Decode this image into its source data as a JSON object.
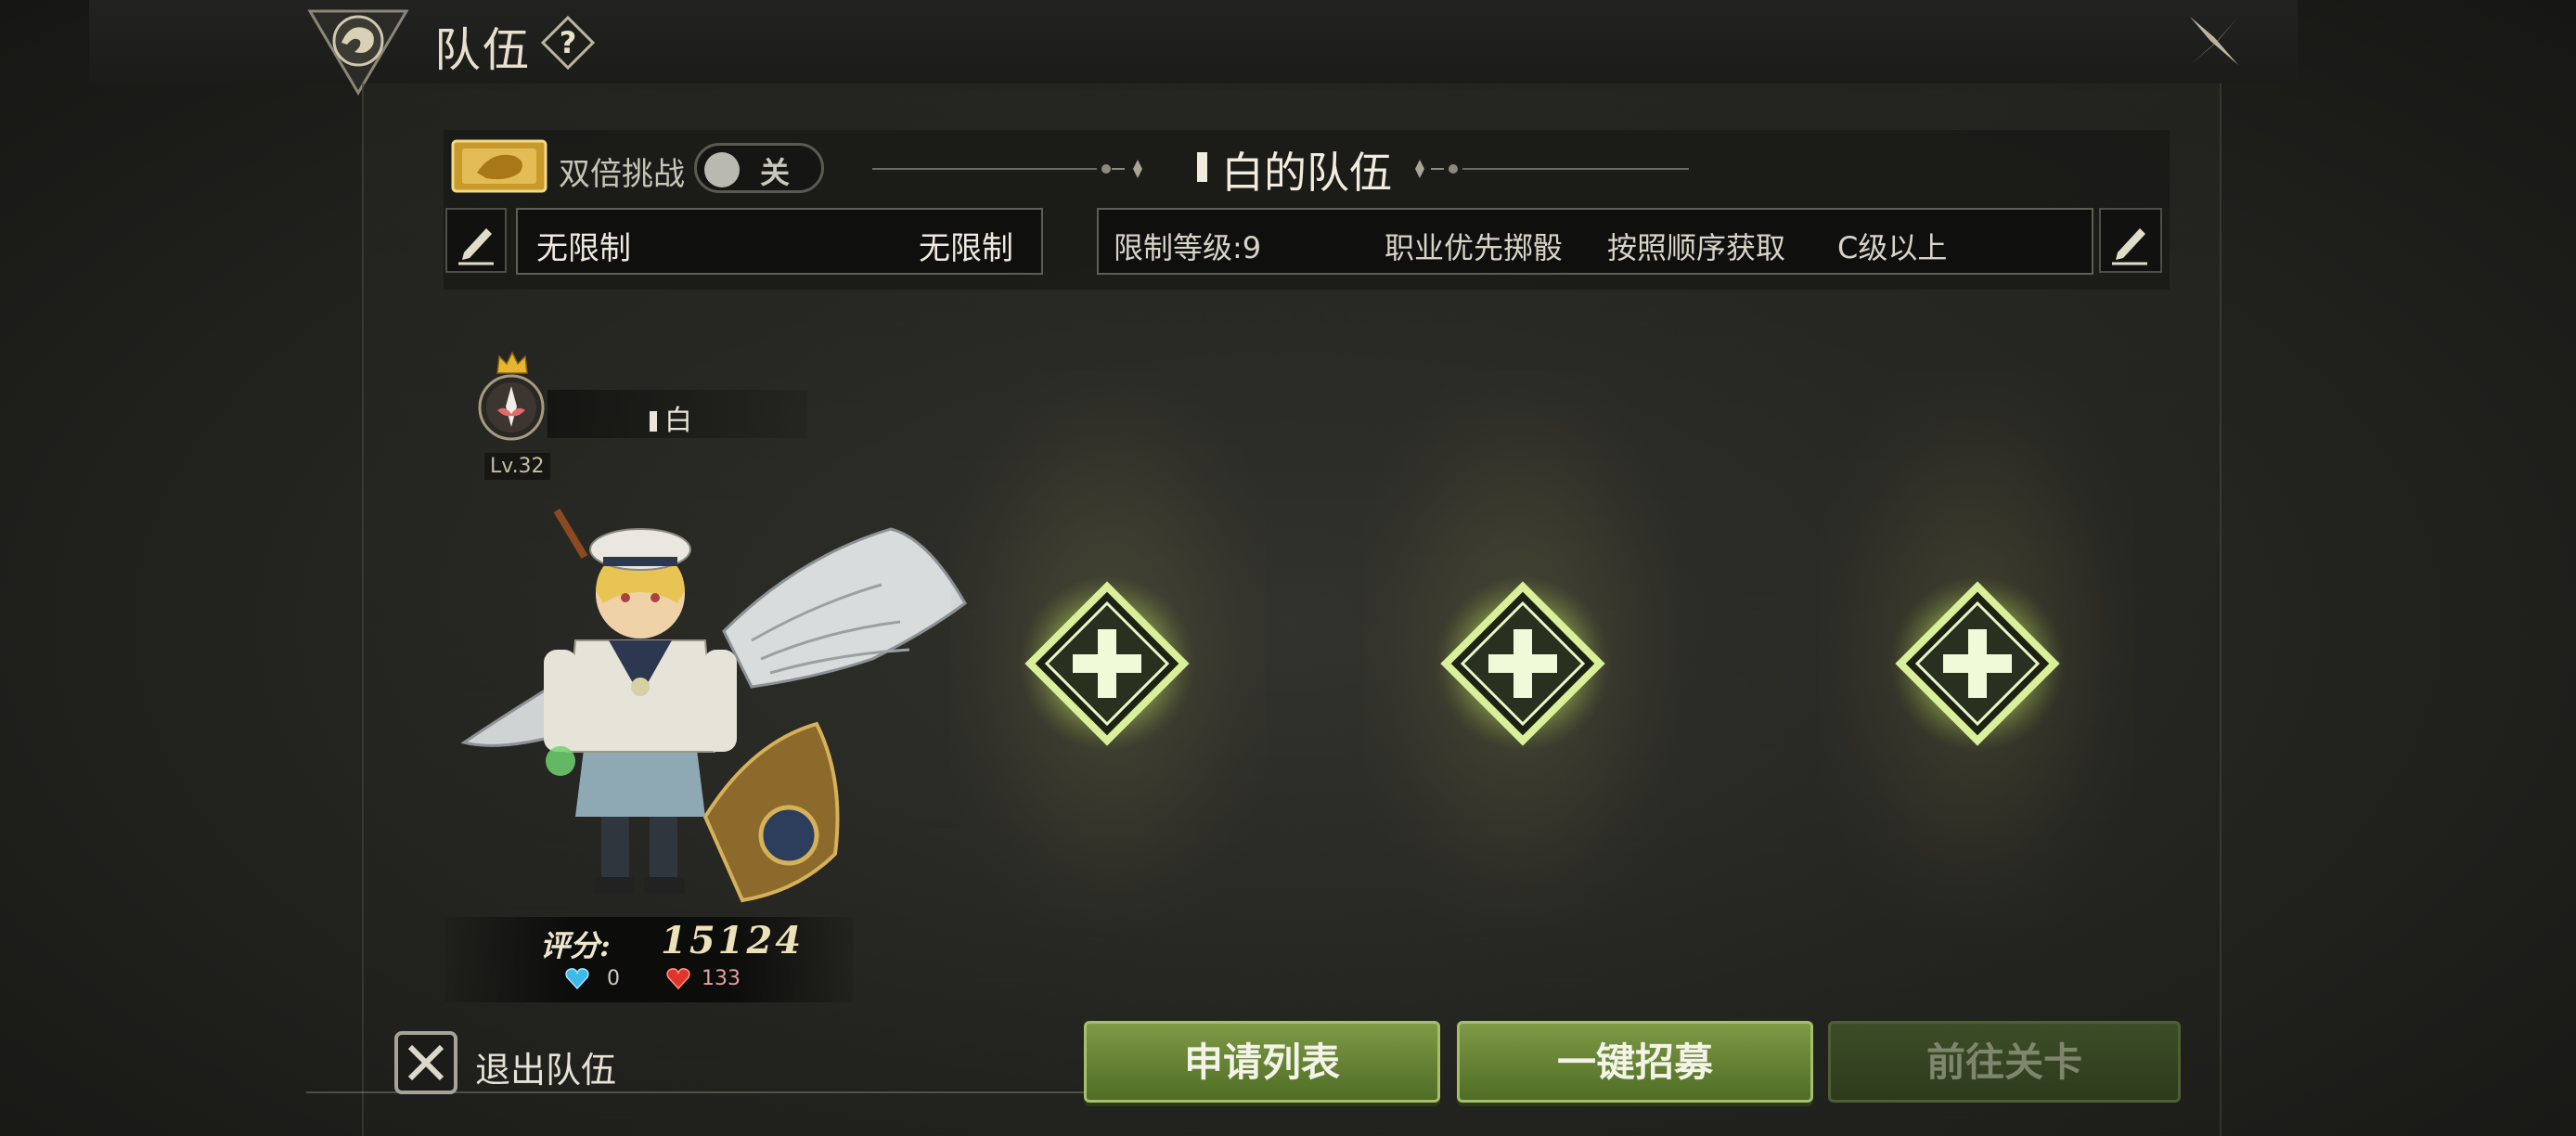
{
  "header": {
    "title": "队伍",
    "help_label": "?"
  },
  "settings": {
    "double_challenge_label": "双倍挑战",
    "double_challenge_state": "关",
    "team_name": "白的队伍",
    "left_conditions": [
      "无限制",
      "无限制"
    ],
    "right_conditions": [
      "限制等级:9",
      "职业优先掷骰",
      "按照顺序获取",
      "C级以上"
    ]
  },
  "member": {
    "name": "白",
    "level": "Lv.32",
    "score_label": "评分:",
    "score": "15124",
    "blue_count": "0",
    "red_count": "133"
  },
  "slots": [
    {
      "icon": "add-icon"
    },
    {
      "icon": "add-icon"
    },
    {
      "icon": "add-icon"
    }
  ],
  "footer": {
    "exit_label": "退出队伍",
    "apply_list": "申请列表",
    "recruit": "一键招募",
    "go_stage": "前往关卡"
  },
  "colors": {
    "primary_button": "#6b8a35",
    "disabled_button": "#34421f",
    "slot_glow": "#d8f090"
  }
}
